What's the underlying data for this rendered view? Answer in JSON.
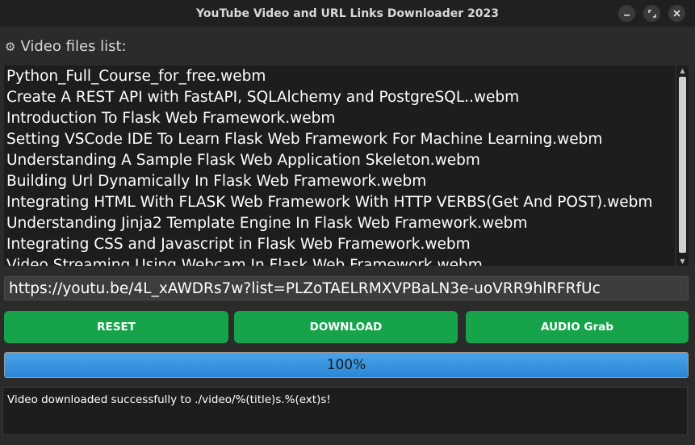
{
  "window": {
    "title": "YouTube Video and URL Links Downloader 2023",
    "minimize_icon": "minimize-icon",
    "restore_icon": "restore-icon",
    "close_icon": "close-icon"
  },
  "files": {
    "label": "Video files list:",
    "label_icon": "gear-icon",
    "items": [
      "Python_Full_Course_for_free.webm",
      "Create A REST API with FastAPI, SQLAlchemy and PostgreSQL..webm",
      "Introduction To Flask Web Framework.webm",
      "Setting VSCode IDE To Learn Flask Web Framework For Machine Learning.webm",
      "Understanding A Sample Flask Web Application Skeleton.webm",
      "Building Url Dynamically In Flask Web Framework.webm",
      "Integrating HTML With FLASK Web Framework With HTTP VERBS(Get And POST).webm",
      "Understanding Jinja2 Template Engine In Flask Web Framework.webm",
      "Integrating CSS and Javascript in Flask Web Framework.webm",
      "Video Streaming Using Webcam In Flask Web Framework.webm"
    ]
  },
  "url_input": {
    "value": "https://youtu.be/4L_xAWDRs7w?list=PLZoTAELRMXVPBaLN3e-uoVRR9hlRFRfUc"
  },
  "buttons": {
    "reset": "RESET",
    "download": "DOWNLOAD",
    "audio": "AUDIO Grab"
  },
  "progress": {
    "value": 100,
    "label": "100%"
  },
  "status": {
    "message": "Video downloaded successfully to ./video/%(title)s.%(ext)s!"
  },
  "colors": {
    "button": "#16a34a",
    "progress": "#2a86d6",
    "background": "#2b2b2b"
  }
}
